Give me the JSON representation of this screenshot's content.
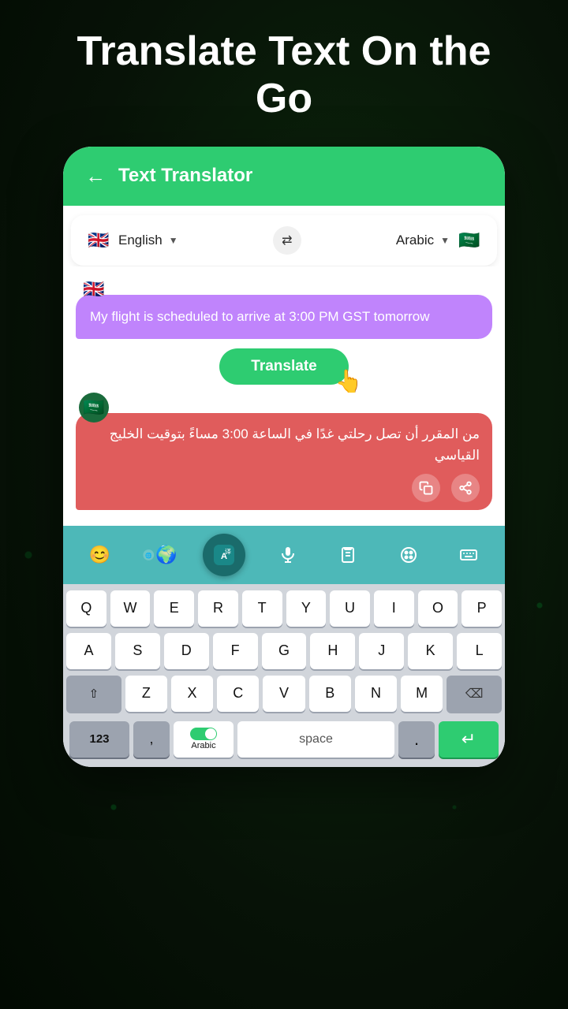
{
  "page": {
    "title_line1": "Translate Text On the",
    "title_line2": "Go"
  },
  "header": {
    "back_label": "←",
    "title": "Text Translator"
  },
  "language_bar": {
    "source_lang": "English",
    "target_lang": "Arabic",
    "swap_icon": "⇄"
  },
  "chat": {
    "user_message": "My flight is scheduled to arrive at 3:00 PM GST tomorrow",
    "translate_button": "Translate",
    "translated_text": "من المقرر أن تصل رحلتي غدًا في الساعة 3:00 مساءً بتوقيت الخليج القياسي"
  },
  "keyboard_toolbar": {
    "items": [
      {
        "name": "emoji",
        "icon": "😊"
      },
      {
        "name": "translate-mic",
        "icon": "🌐"
      },
      {
        "name": "translate-active",
        "icon": "A↔"
      },
      {
        "name": "mic",
        "icon": "🎤"
      },
      {
        "name": "clipboard",
        "icon": "📋"
      },
      {
        "name": "palette",
        "icon": "🎨"
      },
      {
        "name": "keyboard",
        "icon": "⌨"
      }
    ]
  },
  "keyboard": {
    "row1": [
      "Q",
      "W",
      "E",
      "R",
      "T",
      "Y",
      "U",
      "I",
      "O",
      "P"
    ],
    "row2": [
      "A",
      "S",
      "D",
      "F",
      "G",
      "H",
      "J",
      "K",
      "L"
    ],
    "row3": [
      "Z",
      "X",
      "C",
      "V",
      "B",
      "N",
      "M"
    ],
    "bottom": {
      "num_label": "123",
      "comma": ",",
      "arabic_label": "Arabic",
      "space_label": "space",
      "period": ".",
      "enter_icon": "↵"
    }
  },
  "colors": {
    "green": "#2ecc71",
    "purple_bubble": "#c084fc",
    "red_bubble": "#e05c5c",
    "teal_toolbar": "#4db8b8"
  }
}
